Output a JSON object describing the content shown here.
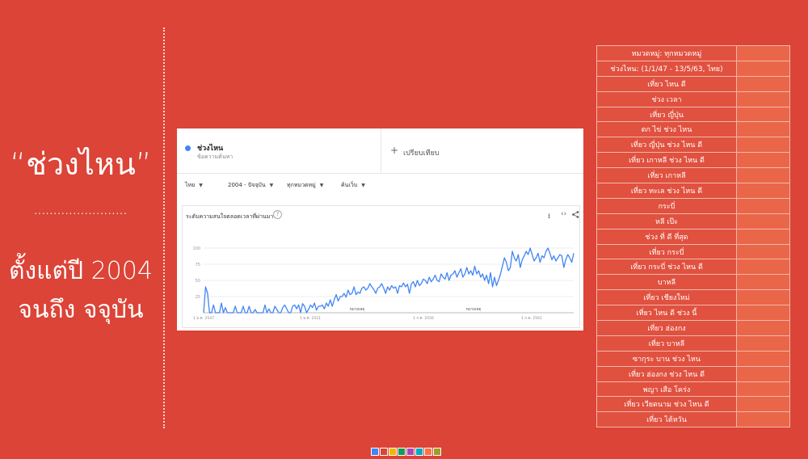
{
  "slide": {
    "title": "“ช่วงไหน”",
    "separator": "........................",
    "subtitle_line1": "ตั้งแต่ปี 2004",
    "subtitle_line2": "จนถึง จจุบัน"
  },
  "trends": {
    "term_name": "ช่วงไหน",
    "term_type": "ข้อความค้นหา",
    "compare_plus": "+",
    "compare_label": "เปรียบเทียบ",
    "filters": [
      "ไทย",
      "2004 - ปัจจุบัน",
      "ทุกหมวดหมู่",
      "ค้นเว็บ"
    ],
    "panel_title": "ระดับความสนใจตลอดเวลาที่ผ่านมา",
    "help_icon": "?",
    "tools": {
      "download_icon": "⭳",
      "embed_icon": "‹›",
      "share_icon": "share-icon"
    },
    "accent": "#4285f4"
  },
  "chart_data": {
    "type": "line",
    "yticks": [
      100,
      75,
      50,
      25
    ],
    "ylim": [
      0,
      100
    ],
    "x_tick_labels": [
      "1 ม.ค. 2547",
      "1 ม.ค. 2551",
      "1 ก.ค. 2556",
      "1 ก.ค. 2561"
    ],
    "annotations": [
      "หมายเหตุ",
      "หมายเหตุ"
    ],
    "series": [
      {
        "color": "#4285f4",
        "values": [
          0,
          40,
          30,
          0,
          0,
          12,
          0,
          0,
          0,
          15,
          0,
          8,
          0,
          0,
          0,
          0,
          10,
          0,
          0,
          0,
          10,
          0,
          0,
          10,
          0,
          0,
          5,
          0,
          0,
          0,
          0,
          12,
          0,
          6,
          0,
          0,
          10,
          5,
          0,
          0,
          8,
          12,
          6,
          0,
          0,
          10,
          12,
          6,
          12,
          0,
          14,
          10,
          0,
          5,
          12,
          8,
          15,
          4,
          10,
          10,
          12,
          6,
          15,
          10,
          20,
          10,
          20,
          28,
          18,
          25,
          25,
          30,
          24,
          35,
          28,
          30,
          40,
          28,
          32,
          30,
          38,
          40,
          35,
          38,
          45,
          40,
          36,
          30,
          38,
          40,
          45,
          38,
          30,
          40,
          35,
          42,
          38,
          40,
          30,
          42,
          40,
          46,
          40,
          44,
          30,
          45,
          48,
          40,
          50,
          42,
          45,
          52,
          50,
          45,
          55,
          48,
          52,
          58,
          50,
          48,
          60,
          55,
          52,
          62,
          50,
          58,
          60,
          65,
          55,
          62,
          68,
          55,
          60,
          70,
          60,
          65,
          58,
          72,
          60,
          65,
          55,
          60,
          50,
          58,
          45,
          62,
          40,
          55,
          42,
          50,
          60,
          72,
          85,
          78,
          65,
          70,
          95,
          85,
          80,
          90,
          70,
          82,
          88,
          95,
          90,
          100,
          90,
          80,
          85,
          92,
          78,
          88,
          85,
          95,
          100,
          92,
          82,
          88,
          80,
          85,
          90,
          88,
          70,
          82,
          90,
          85,
          78,
          92
        ]
      }
    ]
  },
  "table": {
    "rows": [
      "หมวดหมู่: ทุกหมวดหมู่",
      "ช่วงไหน: (1/1/47 - 13/5/63, ไทย)",
      "เที่ยว ไหน ดี",
      "ช่วง เวลา",
      "เที่ยว ญี่ปุ่น",
      "ตก ไข่ ช่วง ไหน",
      "เที่ยว ญี่ปุ่น ช่วง ไหน ดี",
      "เที่ยว เกาหลี ช่วง ไหน ดี",
      "เที่ยว เกาหลี",
      "เที่ยว ทะเล ช่วง ไหน ดี",
      "กระบี่",
      "หลี เป๊ะ",
      "ช่วง ที่ ดี ที่สุด",
      "เที่ยว กระบี่",
      "เที่ยว กระบี่ ช่วง ไหน ดี",
      "บาหลี",
      "เที่ยว เชียงใหม่",
      "เที่ยว ไหน ดี ช่วง นี้",
      "เที่ยว ฮ่องกง",
      "เที่ยว บาหลี",
      "ซากุระ บาน ช่วง ไหน",
      "เที่ยว ฮ่องกง ช่วง ไหน ดี",
      "พญา เสือ โคร่ง",
      "เที่ยว เวียดนาม ช่วง ไหน ดี",
      "เที่ยว ไต้หวัน"
    ]
  },
  "legend_colors": [
    "#4285f4",
    "#db4437",
    "#f4b400",
    "#0f9d58",
    "#ab47bc",
    "#00acc1",
    "#ff7043",
    "#9e9d24"
  ]
}
